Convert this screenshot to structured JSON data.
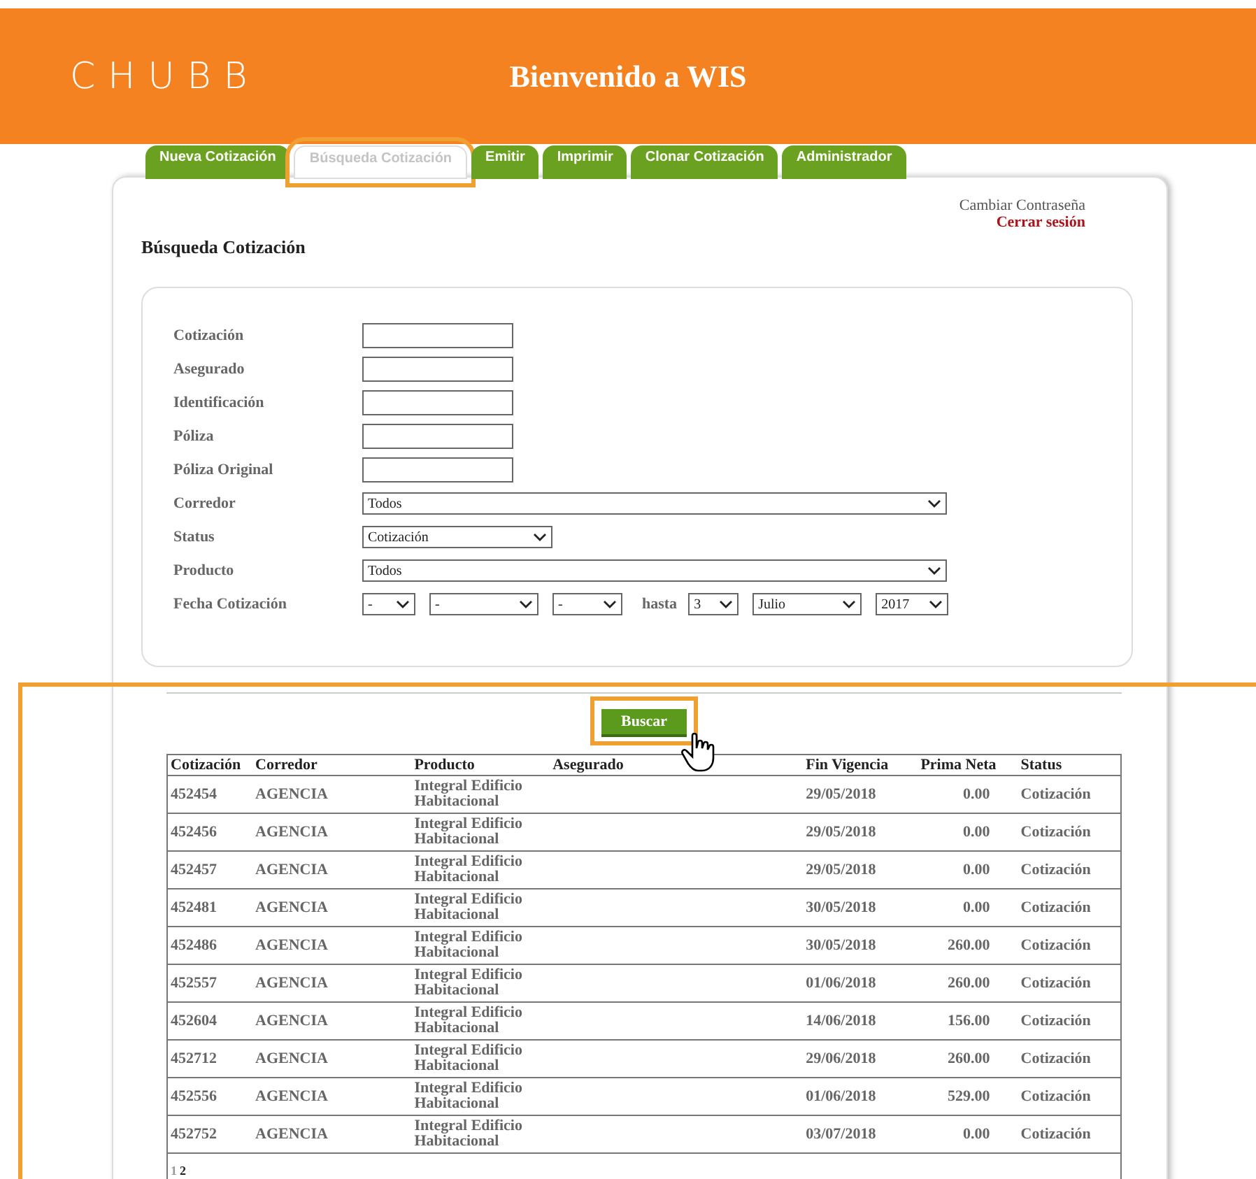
{
  "header": {
    "logo": "CHUBB",
    "title": "Bienvenido a WIS"
  },
  "tabs": [
    {
      "label": "Nueva Cotización",
      "selected": false,
      "highlighted": false
    },
    {
      "label": "Búsqueda Cotización",
      "selected": true,
      "highlighted": true
    },
    {
      "label": "Emitir",
      "selected": false,
      "highlighted": false
    },
    {
      "label": "Imprimir",
      "selected": false,
      "highlighted": false
    },
    {
      "label": "Clonar Cotización",
      "selected": false,
      "highlighted": false
    },
    {
      "label": "Administrador",
      "selected": false,
      "highlighted": false
    }
  ],
  "account_links": [
    "Cambiar Contraseña",
    "Cerrar sesión"
  ],
  "page_title": "Búsqueda Cotización",
  "form": [
    {
      "label": "Cotización",
      "kind": "text"
    },
    {
      "label": "Asegurado",
      "kind": "text"
    },
    {
      "label": "Identificación",
      "kind": "text"
    },
    {
      "label": "Póliza",
      "kind": "text"
    },
    {
      "label": "Póliza Original",
      "kind": "text"
    },
    {
      "label": "Corredor",
      "kind": "select",
      "value": "Todos"
    },
    {
      "label": "Status",
      "kind": "short_select",
      "value": "Cotización"
    },
    {
      "label": "Producto",
      "kind": "select",
      "value": "Todos"
    },
    {
      "label": "Fecha Cotización",
      "kind": "daterange",
      "from": [
        "-",
        "-",
        "-"
      ],
      "separator": "hasta",
      "to": [
        "3",
        "Julio",
        "2017"
      ]
    }
  ],
  "results": {
    "highlighted": true,
    "search_button": {
      "label": "Buscar",
      "highlighted": true
    },
    "columns": [
      "Cotización",
      "Corredor",
      "Producto",
      "Asegurado",
      "Fin Vigencia",
      "Prima Neta",
      "Status"
    ],
    "rows": [
      [
        "452454",
        "AGENCIA",
        "Integral Edificio Habitacional",
        "",
        "29/05/2018",
        "0.00",
        "Cotización"
      ],
      [
        "452456",
        "AGENCIA",
        "Integral Edificio Habitacional",
        "",
        "29/05/2018",
        "0.00",
        "Cotización"
      ],
      [
        "452457",
        "AGENCIA",
        "Integral Edificio Habitacional",
        "",
        "29/05/2018",
        "0.00",
        "Cotización"
      ],
      [
        "452481",
        "AGENCIA",
        "Integral Edificio Habitacional",
        "",
        "30/05/2018",
        "0.00",
        "Cotización"
      ],
      [
        "452486",
        "AGENCIA",
        "Integral Edificio Habitacional",
        "",
        "30/05/2018",
        "260.00",
        "Cotización"
      ],
      [
        "452557",
        "AGENCIA",
        "Integral Edificio Habitacional",
        "",
        "01/06/2018",
        "260.00",
        "Cotización"
      ],
      [
        "452604",
        "AGENCIA",
        "Integral Edificio Habitacional",
        "",
        "14/06/2018",
        "156.00",
        "Cotización"
      ],
      [
        "452712",
        "AGENCIA",
        "Integral Edificio Habitacional",
        "",
        "29/06/2018",
        "260.00",
        "Cotización"
      ],
      [
        "452556",
        "AGENCIA",
        "Integral Edificio Habitacional",
        "",
        "01/06/2018",
        "529.00",
        "Cotización"
      ],
      [
        "452752",
        "AGENCIA",
        "Integral Edificio Habitacional",
        "",
        "03/07/2018",
        "0.00",
        "Cotización"
      ]
    ],
    "pages": [
      {
        "label": "1",
        "selected": true
      },
      {
        "label": "2",
        "selected": false
      }
    ]
  }
}
